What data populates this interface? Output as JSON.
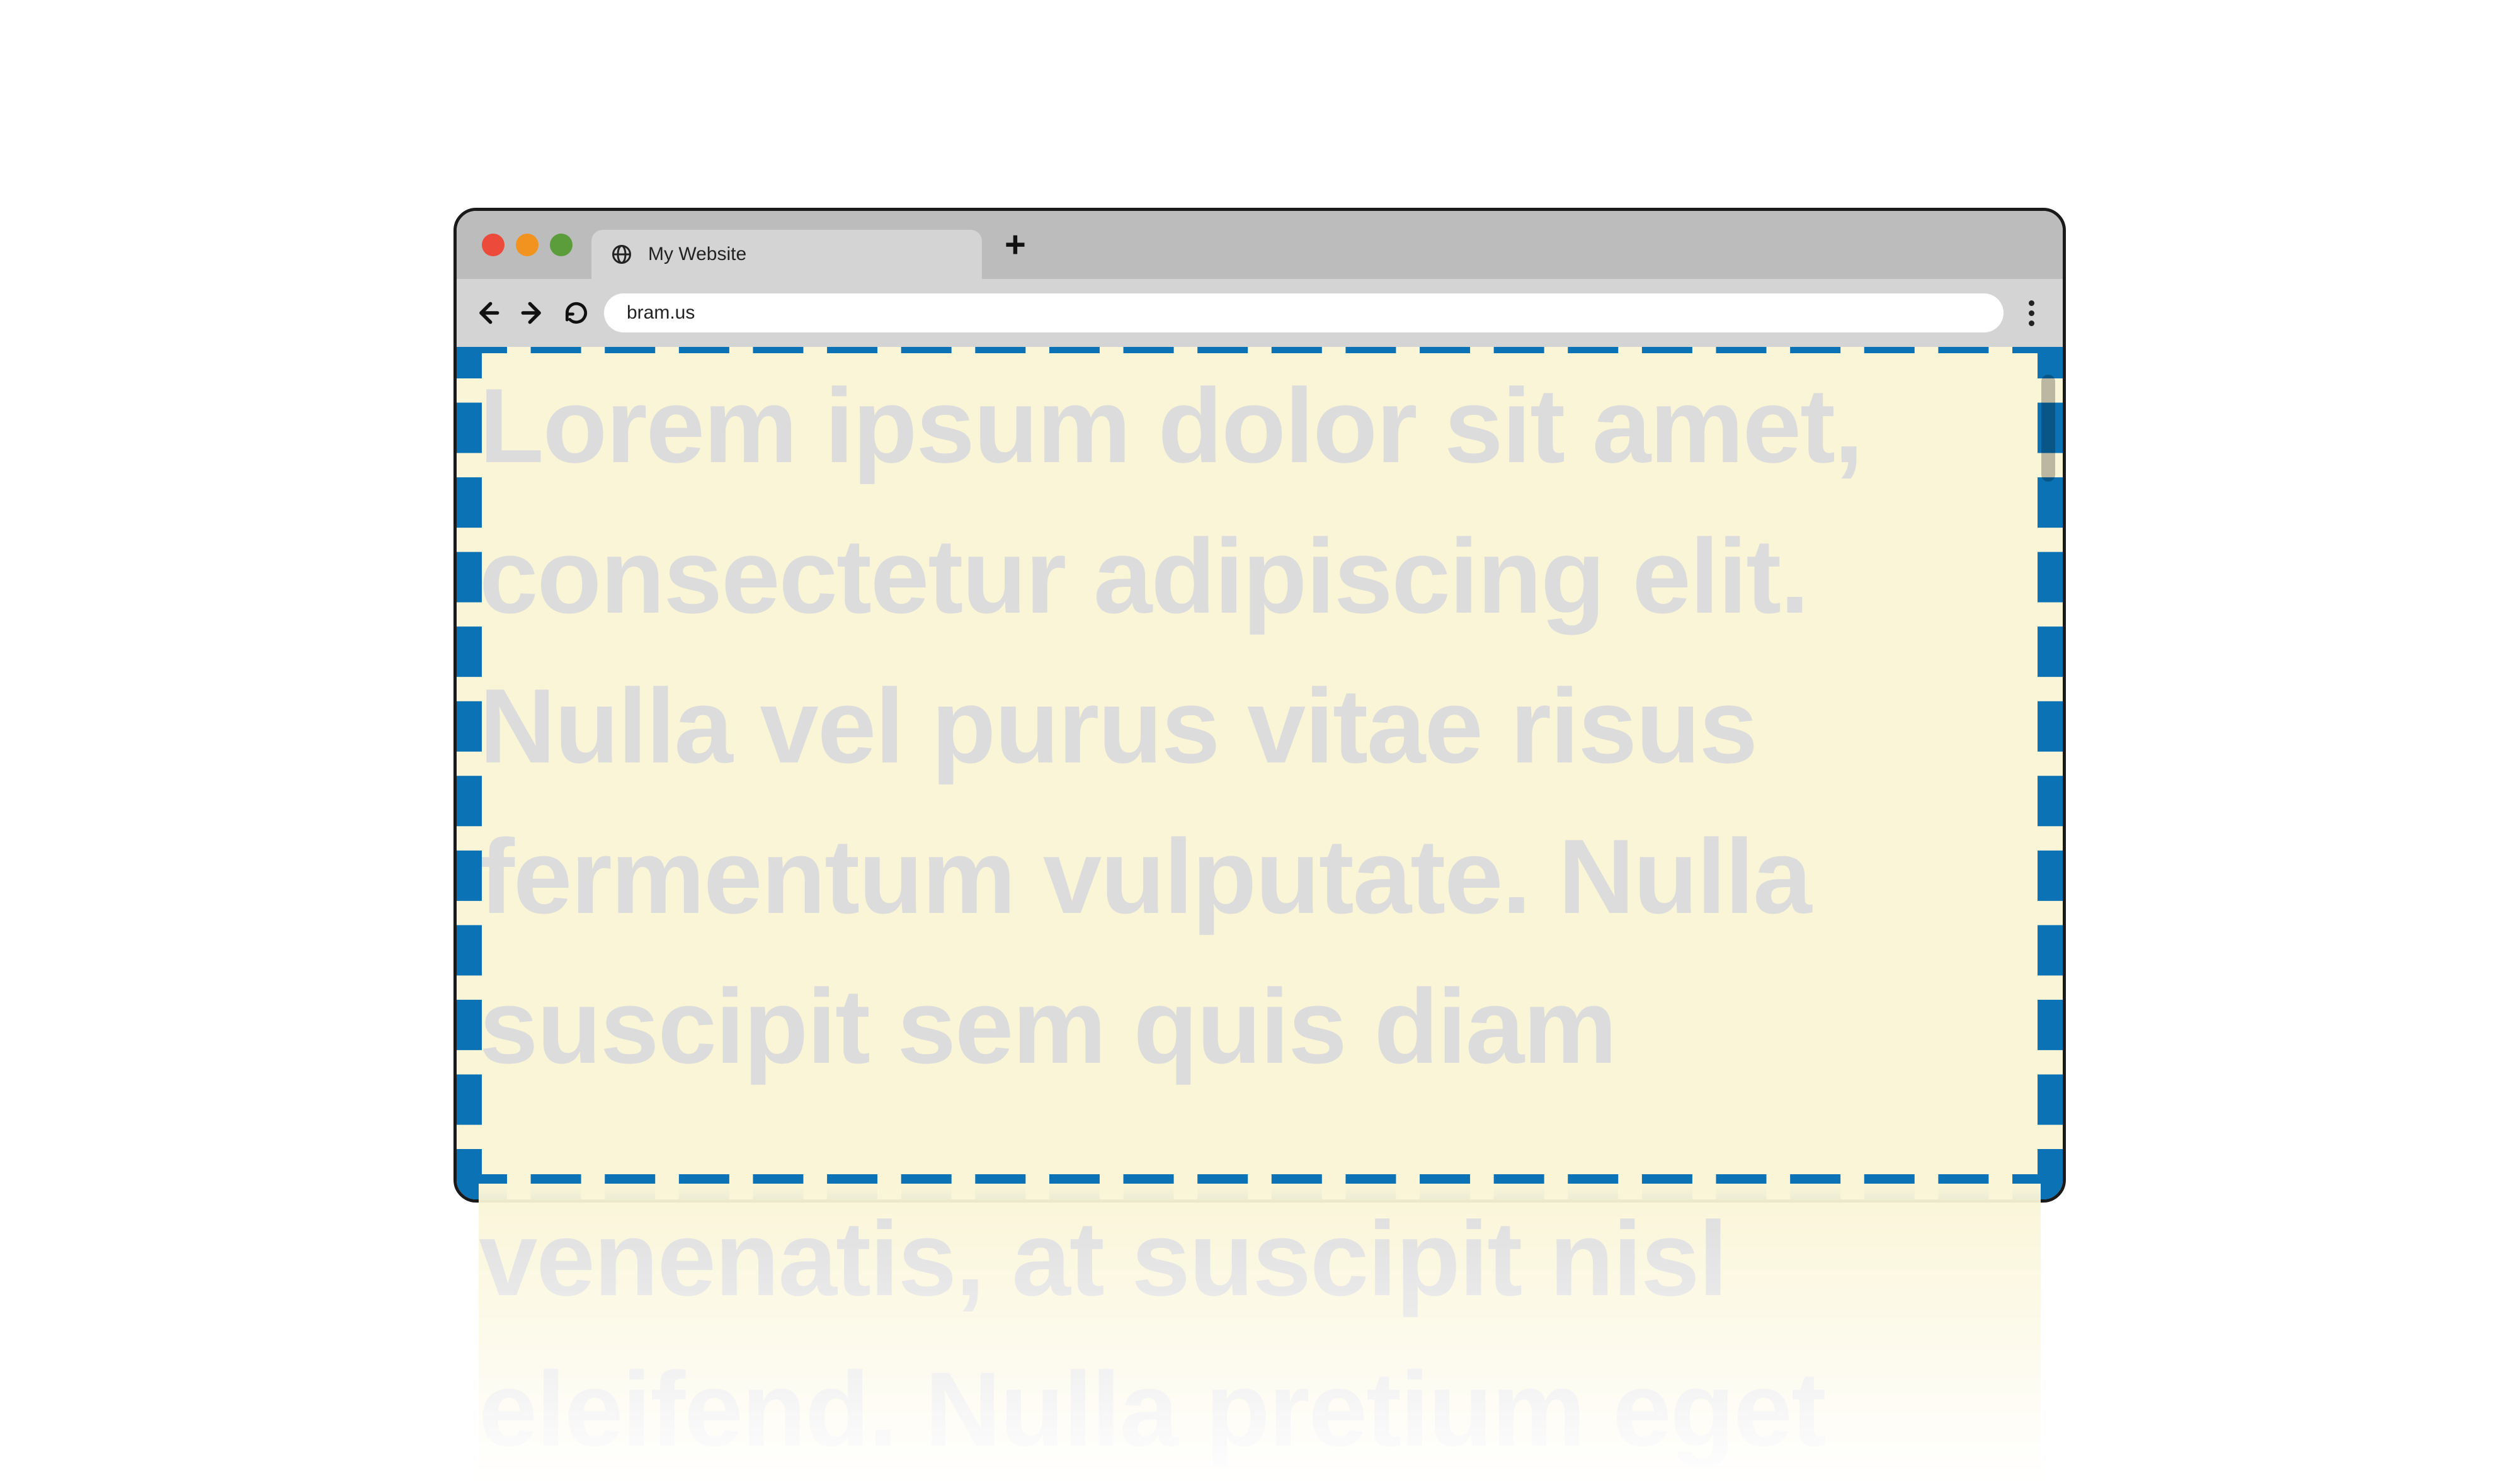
{
  "browser": {
    "tab": {
      "title": "My Website"
    },
    "url": "bram.us"
  },
  "page": {
    "body_text": "Lorem ipsum dolor sit amet, consectetur adipiscing elit. Nulla vel purus vitae risus fermentum vulputate. Nulla suscipit sem quis diam",
    "overflow_text_line_1": "venenatis, at suscipit nisl",
    "overflow_text_line_2": "eleifend. Nulla pretium eget"
  },
  "colors": {
    "page_bg": "#faf5d7",
    "dashed_border": "#0b72b6",
    "text": "#dcdcdc"
  }
}
